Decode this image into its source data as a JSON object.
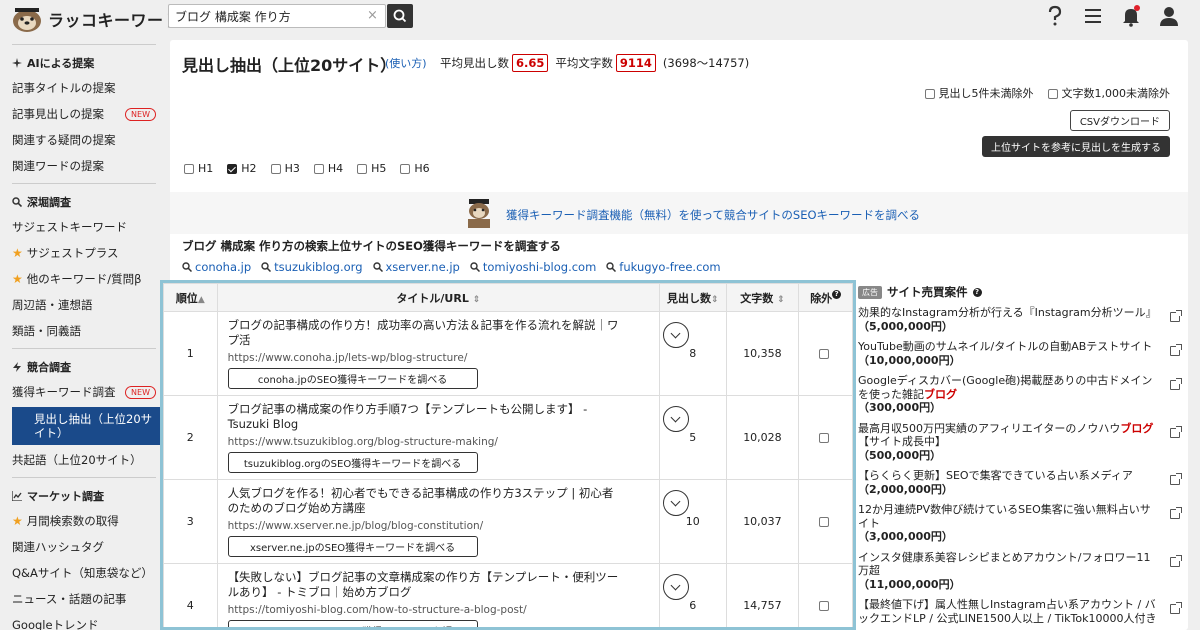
{
  "app": {
    "name": "ラッコキーワード"
  },
  "search": {
    "value": "ブログ 構成案 作り方",
    "clear": "×"
  },
  "topicons": [
    "help-icon",
    "menu-icon",
    "bell-icon",
    "user-icon"
  ],
  "sidebar": {
    "sections": [
      {
        "title": "AIによる提案",
        "items": [
          {
            "label": "記事タイトルの提案"
          },
          {
            "label": "記事見出しの提案",
            "badge": "NEW"
          },
          {
            "label": "関連する疑問の提案"
          },
          {
            "label": "関連ワードの提案"
          }
        ]
      },
      {
        "title": "深堀調査",
        "items": [
          {
            "label": "サジェストキーワード"
          },
          {
            "label": "サジェストプラス",
            "star": true
          },
          {
            "label": "他のキーワード/質問β",
            "star": true
          },
          {
            "label": "周辺語・連想語"
          },
          {
            "label": "類語・同義語"
          }
        ]
      },
      {
        "title": "競合調査",
        "items": [
          {
            "label": "獲得キーワード調査",
            "badge": "NEW"
          },
          {
            "label": "見出し抽出（上位20サイト）",
            "active": true
          },
          {
            "label": "共起語（上位20サイト）"
          }
        ]
      },
      {
        "title": "マーケット調査",
        "items": [
          {
            "label": "月間検索数の取得",
            "star": true
          },
          {
            "label": "関連ハッシュタグ"
          },
          {
            "label": "Q&Aサイト（知恵袋など）"
          },
          {
            "label": "ニュース・話題の記事"
          },
          {
            "label": "Googleトレンド"
          }
        ]
      }
    ]
  },
  "main": {
    "title": "見出し抽出（上位20サイト）",
    "howto": "(使い方)",
    "avg_heading_label": "平均見出し数",
    "avg_heading": "6.65",
    "avg_chars_label": "平均文字数",
    "avg_chars": "9114",
    "range": "(3698〜14757)",
    "opt1": "見出し5件未満除外",
    "opt2": "文字数1,000未満除外",
    "csv": "CSVダウンロード",
    "generate": "上位サイトを参考に見出しを生成する",
    "headings": [
      {
        "label": "H1",
        "checked": false
      },
      {
        "label": "H2",
        "checked": true
      },
      {
        "label": "H3",
        "checked": false
      },
      {
        "label": "H4",
        "checked": false
      },
      {
        "label": "H5",
        "checked": false
      },
      {
        "label": "H6",
        "checked": false
      }
    ],
    "band_link": "獲得キーワード調査機能（無料）を使って競合サイトのSEOキーワードを調べる",
    "kw_title": "ブログ 構成案 作り方の検索上位サイトのSEO獲得キーワードを調査する",
    "kw_links": [
      "conoha.jp",
      "tsuzukiblog.org",
      "xserver.ne.jp",
      "tomiyoshi-blog.com",
      "fukugyo-free.com"
    ]
  },
  "table": {
    "headers": {
      "rank": "順位",
      "title": "タイトル/URL",
      "headings": "見出し数",
      "chars": "文字数",
      "exclude": "除外"
    },
    "rows": [
      {
        "rank": "1",
        "title": "ブログの記事構成の作り方！成功率の高い方法＆記事を作る流れを解説｜ワプ活",
        "url": "https://www.conoha.jp/lets-wp/blog-structure/",
        "button": "conoha.jpのSEO獲得キーワードを調べる",
        "headings": "8",
        "chars": "10,358"
      },
      {
        "rank": "2",
        "title": "ブログ記事の構成案の作り方手順7つ【テンプレートも公開します】 - Tsuzuki Blog",
        "url": "https://www.tsuzukiblog.org/blog-structure-making/",
        "button": "tsuzukiblog.orgのSEO獲得キーワードを調べる",
        "headings": "5",
        "chars": "10,028"
      },
      {
        "rank": "3",
        "title": "人気ブログを作る！初心者でもできる記事構成の作り方3ステップ | 初心者のためのブログ始め方講座",
        "url": "https://www.xserver.ne.jp/blog/blog-constitution/",
        "button": "xserver.ne.jpのSEO獲得キーワードを調べる",
        "headings": "10",
        "chars": "10,037"
      },
      {
        "rank": "4",
        "title": "【失敗しない】ブログ記事の文章構成案の作り方【テンプレート・便利ツールあり】 - トミブロ｜始め方ブログ",
        "url": "https://tomiyoshi-blog.com/how-to-structure-a-blog-post/",
        "button": "tomiyoshi-blog.comのSEO獲得キーワードを調べる",
        "headings": "6",
        "chars": "14,757"
      }
    ]
  },
  "ads": {
    "tag": "広告",
    "title": "サイト売買案件",
    "items": [
      {
        "pre": "効果的なInstagram分析が行える『Instagram分析ツール』",
        "hl": "",
        "post": "",
        "price": "（5,000,000円）"
      },
      {
        "pre": "YouTube動画のサムネイル/タイトルの自動ABテストサイト",
        "hl": "",
        "post": "",
        "price": "（10,000,000円）"
      },
      {
        "pre": "Googleディスカバー(Google砲)掲載歴ありの中古ドメインを使った雑記",
        "hl": "ブログ",
        "post": "",
        "price": "（300,000円）"
      },
      {
        "pre": "最高月収500万円実績のアフィリエイターのノウハウ",
        "hl": "ブログ",
        "post": "【サイト成長中】",
        "price": "（500,000円）"
      },
      {
        "pre": "【らくらく更新】SEOで集客できている占い系メディア",
        "hl": "",
        "post": "",
        "price": "（2,000,000円）"
      },
      {
        "pre": "12か月連続PV数伸び続けているSEO集客に強い無料占いサイト",
        "hl": "",
        "post": "",
        "price": "（3,000,000円）"
      },
      {
        "pre": "インスタ健康系美容レシピまとめアカウント/フォロワー11万超",
        "hl": "",
        "post": "",
        "price": "（11,000,000円）"
      },
      {
        "pre": "【最終値下げ】属人性無しInstagram占い系アカウント / バックエンドLP / 公式LINE1500人以上 / TikTok10000人付き",
        "hl": "",
        "post": "",
        "price": ""
      }
    ]
  }
}
